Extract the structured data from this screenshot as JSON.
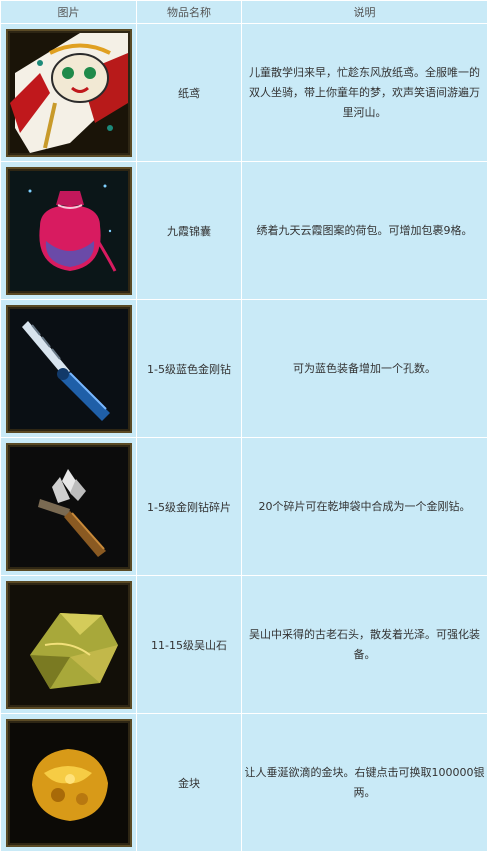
{
  "header": {
    "col_image": "图片",
    "col_name": "物品名称",
    "col_desc": "说明"
  },
  "rows": [
    {
      "icon": "kite-icon",
      "name": "纸鸢",
      "desc": "儿童散学归来早，忙趁东风放纸鸢。全服唯一的双人坐骑，带上你童年的梦，欢声笑语间游遍万里河山。"
    },
    {
      "icon": "pouch-icon",
      "name": "九霞锦囊",
      "desc": "绣着九天云霞图案的荷包。可增加包裹9格。"
    },
    {
      "icon": "blue-diamond-drill-icon",
      "name": "1-5级蓝色金刚钻",
      "desc": "可为蓝色装备增加一个孔数。"
    },
    {
      "icon": "diamond-drill-fragment-icon",
      "name": "1-5级金刚钻碎片",
      "desc": "20个碎片可在乾坤袋中合成为一个金刚钻。"
    },
    {
      "icon": "wushan-stone-icon",
      "name": "11-15级吴山石",
      "desc": "吴山中采得的古老石头，散发着光泽。可强化装备。"
    },
    {
      "icon": "gold-nugget-icon",
      "name": "金块",
      "desc": "让人垂涎欲滴的金块。右键点击可换取100000银两。"
    }
  ]
}
